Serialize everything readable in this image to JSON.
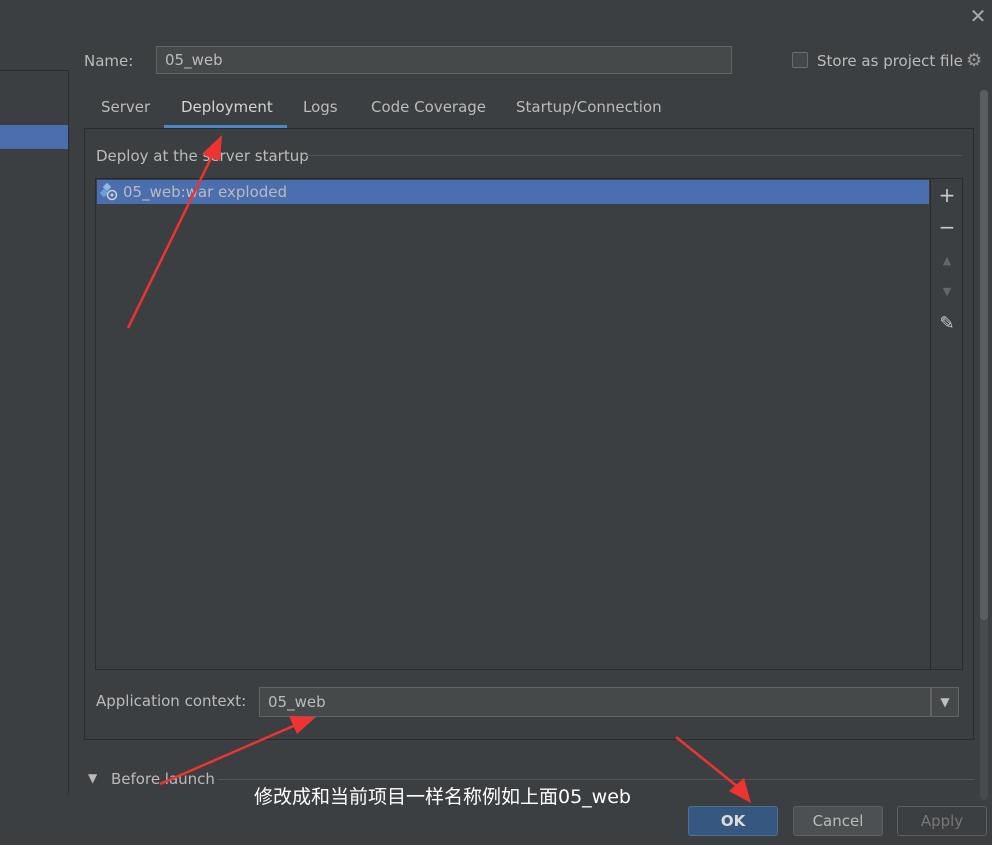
{
  "window": {
    "close_glyph": "✕"
  },
  "name": {
    "label": "Name:",
    "value": "05_web"
  },
  "store": {
    "label": "Store as project file",
    "checked": false,
    "gear_icon": "gear-icon"
  },
  "tabs": [
    {
      "label": "Server"
    },
    {
      "label": "Deployment",
      "active": true
    },
    {
      "label": "Logs"
    },
    {
      "label": "Code Coverage"
    },
    {
      "label": "Startup/Connection"
    }
  ],
  "deploy": {
    "title": "Deploy at the server startup",
    "items": [
      {
        "label": "05_web:war exploded",
        "selected": true,
        "icon": "artifact-icon"
      }
    ],
    "toolbar": {
      "add": "+",
      "remove": "−",
      "up": "▲",
      "down": "▼",
      "edit": "✎"
    }
  },
  "context": {
    "label": "Application context:",
    "value": "05_web",
    "dropdown_glyph": "▼"
  },
  "before_launch": {
    "label": "Before launch",
    "arrow": "▼"
  },
  "annotation": {
    "text": "修改成和当前项目一样名称例如上面05_web",
    "arrow_color": "#ee3333"
  },
  "buttons": {
    "ok": "OK",
    "cancel": "Cancel",
    "apply": "Apply"
  },
  "colors": {
    "bg": "#3c3f41",
    "selection": "#4b6eaf",
    "tab_underline": "#4a88c7",
    "ok": "#365880"
  }
}
